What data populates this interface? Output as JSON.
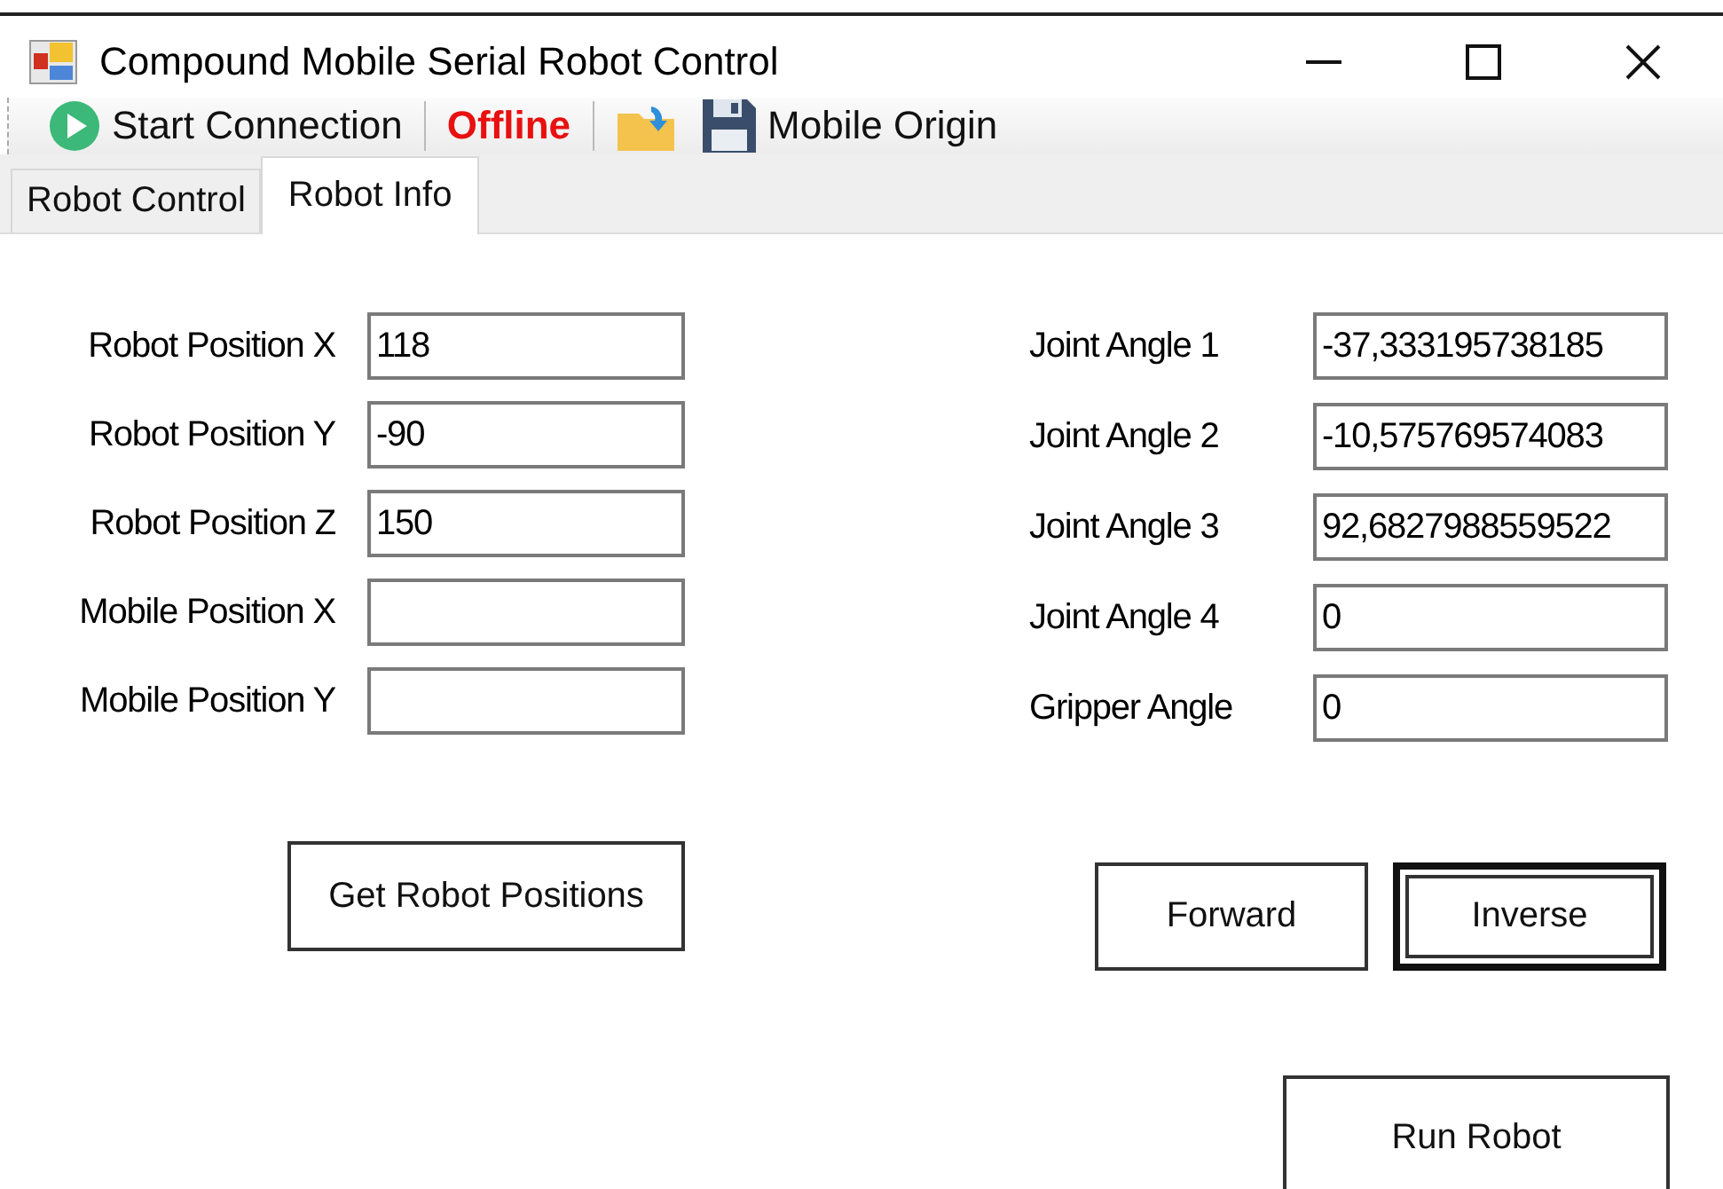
{
  "window": {
    "title": "Compound Mobile Serial Robot Control"
  },
  "toolbar": [
    {
      "kind": "play",
      "label": "Start Connection"
    },
    {
      "kind": "status",
      "label": "Offline"
    },
    {
      "kind": "folder"
    },
    {
      "kind": "save",
      "label": "Mobile Origin"
    }
  ],
  "tabs": [
    {
      "label": "Robot Control",
      "selected": false
    },
    {
      "label": "Robot Info",
      "selected": true
    }
  ],
  "position_fields": [
    {
      "label": "Robot Position X",
      "value": "118"
    },
    {
      "label": "Robot Position Y",
      "value": "-90"
    },
    {
      "label": "Robot Position Z",
      "value": "150"
    },
    {
      "label": "Mobile Position X"
    },
    {
      "label": "Mobile Position Y"
    }
  ],
  "angle_fields": [
    {
      "label": "Joint Angle 1",
      "value": "-37,333195738185"
    },
    {
      "label": "Joint Angle 2",
      "value": "-10,575769574083"
    },
    {
      "label": "Joint Angle 3",
      "value": "92,6827988559522"
    },
    {
      "label": "Joint Angle 4",
      "value": "0"
    },
    {
      "label": "Gripper Angle",
      "value": "0"
    }
  ],
  "buttons": [
    {
      "label": "Get Robot Positions",
      "focused": false
    },
    {
      "label": "Forward",
      "focused": false
    },
    {
      "label": "Inverse",
      "focused": true
    },
    {
      "label": "Run Robot",
      "focused": false
    }
  ]
}
